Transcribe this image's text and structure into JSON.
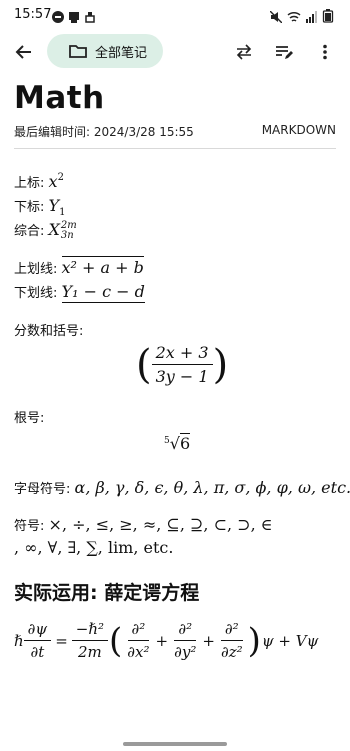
{
  "status": {
    "time": "15:57",
    "battery_level": "high"
  },
  "toolbar": {
    "back_icon": "arrow-left-icon",
    "folder_label": "全部笔记",
    "folder_icon": "folder-icon",
    "swap_icon": "swap-icon",
    "format_icon": "edit-list-icon",
    "more_icon": "more-vertical-icon",
    "chip_color": "#dcefe6"
  },
  "note": {
    "title": "Math",
    "meta_label": "最后编辑时间:",
    "meta_time": "2024/3/28 15:55",
    "format": "MARKDOWN"
  },
  "content": {
    "sup_label": "上标:",
    "sub_label": "下标:",
    "combo_label": "综合:",
    "overline_label": "上划线:",
    "underline_label": "下划线:",
    "frac_label": "分数和括号:",
    "root_label": "根号:",
    "greek_label": "字母符号:",
    "symbol_label": "符号:",
    "math_x2_base": "x",
    "math_x2_exp": "2",
    "math_y1_base": "Y",
    "math_y1_sub": "1",
    "math_combo_base": "X",
    "math_combo_sup": "2m",
    "math_combo_sub": "3n",
    "overline_expr": "x² + a + b",
    "underline_expr": "Y₁ − c − d",
    "frac_num": "2x + 3",
    "frac_den": "3y − 1",
    "root_index": "5",
    "root_radicand": "6",
    "greek_list": "α, β, γ, δ, ϵ, θ, λ, π, σ, ϕ, φ, ω, etc.",
    "symbols_line1": "×, ÷, ≤, ≥, ≈, ⊆, ⊇, ⊂, ⊃, ∈",
    "symbols_line2": ", ∞, ∀, ∃, ∑, lim, etc.",
    "heading": "实际运用: 薛定谔方程",
    "eq_hbar": "ℏ",
    "eq_dpsi": "∂ψ",
    "eq_dt": "∂t",
    "eq_num2": "−ℏ²",
    "eq_den2": "2m",
    "eq_d2": "∂²",
    "eq_dx2": "∂x²",
    "eq_dy2": "∂y²",
    "eq_dz2": "∂z²",
    "eq_tail": "ψ + Vψ"
  }
}
